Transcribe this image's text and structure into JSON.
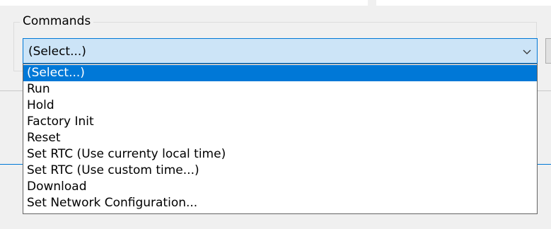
{
  "commands_group": {
    "title": "Commands",
    "selected_value": "(Select...)",
    "options": [
      "(Select...)",
      "Run",
      "Hold",
      "Factory Init",
      "Reset",
      "Set RTC (Use currenty local time)",
      "Set RTC (Use custom time...)",
      "Download",
      "Set Network Configuration..."
    ],
    "highlighted_index": 0
  },
  "icons": {
    "combo_arrow": "chevron-down-icon"
  },
  "colors": {
    "selection": "#0078d7",
    "combo_background": "#cce4f7",
    "window_background": "#f0f0f0"
  }
}
